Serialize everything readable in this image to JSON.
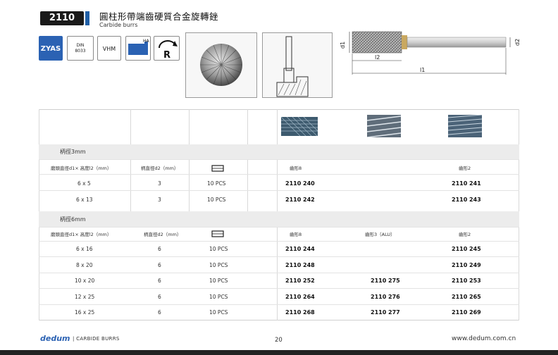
{
  "header": {
    "code": "2110",
    "title_zh": "圓柱形帶端齒硬質合金旋轉銼",
    "title_en": "Carbide burrs"
  },
  "specs": {
    "zyas": "ZYAS",
    "din_line1": "DIN",
    "din_line2": "8033",
    "vhm": "VHM",
    "ha": "HA",
    "r": "R"
  },
  "diagram": {
    "d1": "d1",
    "d2": "d2",
    "l1": "l1",
    "l2": "l2"
  },
  "section1": {
    "title": "柄徑3mm",
    "col_size": "磨頭直徑d1× 高度l2（mm）",
    "col_shank": "柄直徑d2（mm）",
    "col_tooth1": "齒形8",
    "col_tooth3": "齒形2",
    "rows": [
      {
        "size": "6 x 5",
        "shank": "3",
        "pack": "10  PCS",
        "a": "2110 240",
        "b": "",
        "c": "2110 241"
      },
      {
        "size": "6 x 13",
        "shank": "3",
        "pack": "10  PCS",
        "a": "2110 242",
        "b": "",
        "c": "2110 243"
      }
    ]
  },
  "section2": {
    "title": "柄徑6mm",
    "col_size": "磨頭直徑d1× 高度l2（mm）",
    "col_shank": "柄直徑d2（mm）",
    "col_tooth1": "齒形8",
    "col_tooth2": "齒形3（ALU）",
    "col_tooth3": "齒形2",
    "rows": [
      {
        "size": "6 x 16",
        "shank": "6",
        "pack": "10  PCS",
        "a": "2110 244",
        "b": "",
        "c": "2110 245"
      },
      {
        "size": "8 x 20",
        "shank": "6",
        "pack": "10  PCS",
        "a": "2110 248",
        "b": "",
        "c": "2110 249"
      },
      {
        "size": "10 x 20",
        "shank": "6",
        "pack": "10  PCS",
        "a": "2110 252",
        "b": "2110 275",
        "c": "2110 253"
      },
      {
        "size": "12 x 25",
        "shank": "6",
        "pack": "10  PCS",
        "a": "2110 264",
        "b": "2110 276",
        "c": "2110 265"
      },
      {
        "size": "16 x 25",
        "shank": "6",
        "pack": "10  PCS",
        "a": "2110 268",
        "b": "2110 277",
        "c": "2110 269"
      }
    ]
  },
  "footer": {
    "brand": "dedum",
    "sub": "| CARBIDE BURRS",
    "page": "20",
    "website": "www.dedum.com.cn"
  },
  "colors": {
    "accent": "#2b62b3",
    "band": "#ececec"
  }
}
